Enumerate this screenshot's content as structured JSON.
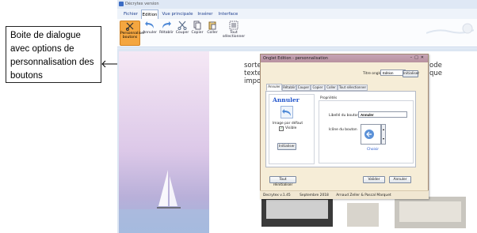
{
  "callout": {
    "lines": [
      "Boite de dialogue",
      "avec options de",
      "personnalisation des",
      "boutons"
    ]
  },
  "app": {
    "window_title": "Décrytex version",
    "tabs": [
      "Fichier",
      "Edition",
      "Vue principale",
      "Insérer",
      "Interface"
    ],
    "active_tab": "Edition",
    "ribbon": [
      {
        "label": "Personnaliser boutons",
        "icon": "scissors-tool-icon",
        "selected": true
      },
      {
        "label": "Annuler",
        "icon": "undo-icon"
      },
      {
        "label": "Rétablir",
        "icon": "redo-icon"
      },
      {
        "label": "Couper",
        "icon": "cut-icon"
      },
      {
        "label": "Copier",
        "icon": "copy-icon"
      },
      {
        "label": "Coller",
        "icon": "paste-icon"
      },
      {
        "label": "Tout sélectionner",
        "icon": "select-all-icon"
      }
    ]
  },
  "document": {
    "lines": [
      "sorte",
      "texte",
      "impo"
    ],
    "right_lines": [
      "ode",
      "que"
    ]
  },
  "dialog": {
    "title": "Onglet Edition - personnalisation",
    "tab_title_label": "Titre onglet",
    "tab_title_value": "Edition",
    "init_button": "Initialiser",
    "inner_tabs": [
      "Annuler",
      "Rétablir",
      "Couper",
      "Copier",
      "Coller",
      "Tout sélectionner"
    ],
    "active_inner_tab": "Annuler",
    "preview_label": "Annuler",
    "default_image_label": "Image par défaut",
    "visible_label": "Visible",
    "init_button_inner": "Initialiser",
    "properties_title": "Propriétés",
    "button_text_label": "Libellé du bouton",
    "button_text_value": "Annuler",
    "button_icon_label": "Icône du bouton",
    "choose_label": "Choisir",
    "reset_all_button": "Tout réinitialiser",
    "ok_button": "Valider",
    "cancel_button": "Annuler",
    "status": [
      "Decrytex v.1.45",
      "Septembre 2018",
      "Arnaud Zeller & Pascal Marquet"
    ]
  },
  "colors": {
    "accent": "#f4a640",
    "dialog_bg": "#f6edd7",
    "ribbon_tab_text": "#1e3f8f",
    "link_blue": "#2255cc"
  }
}
